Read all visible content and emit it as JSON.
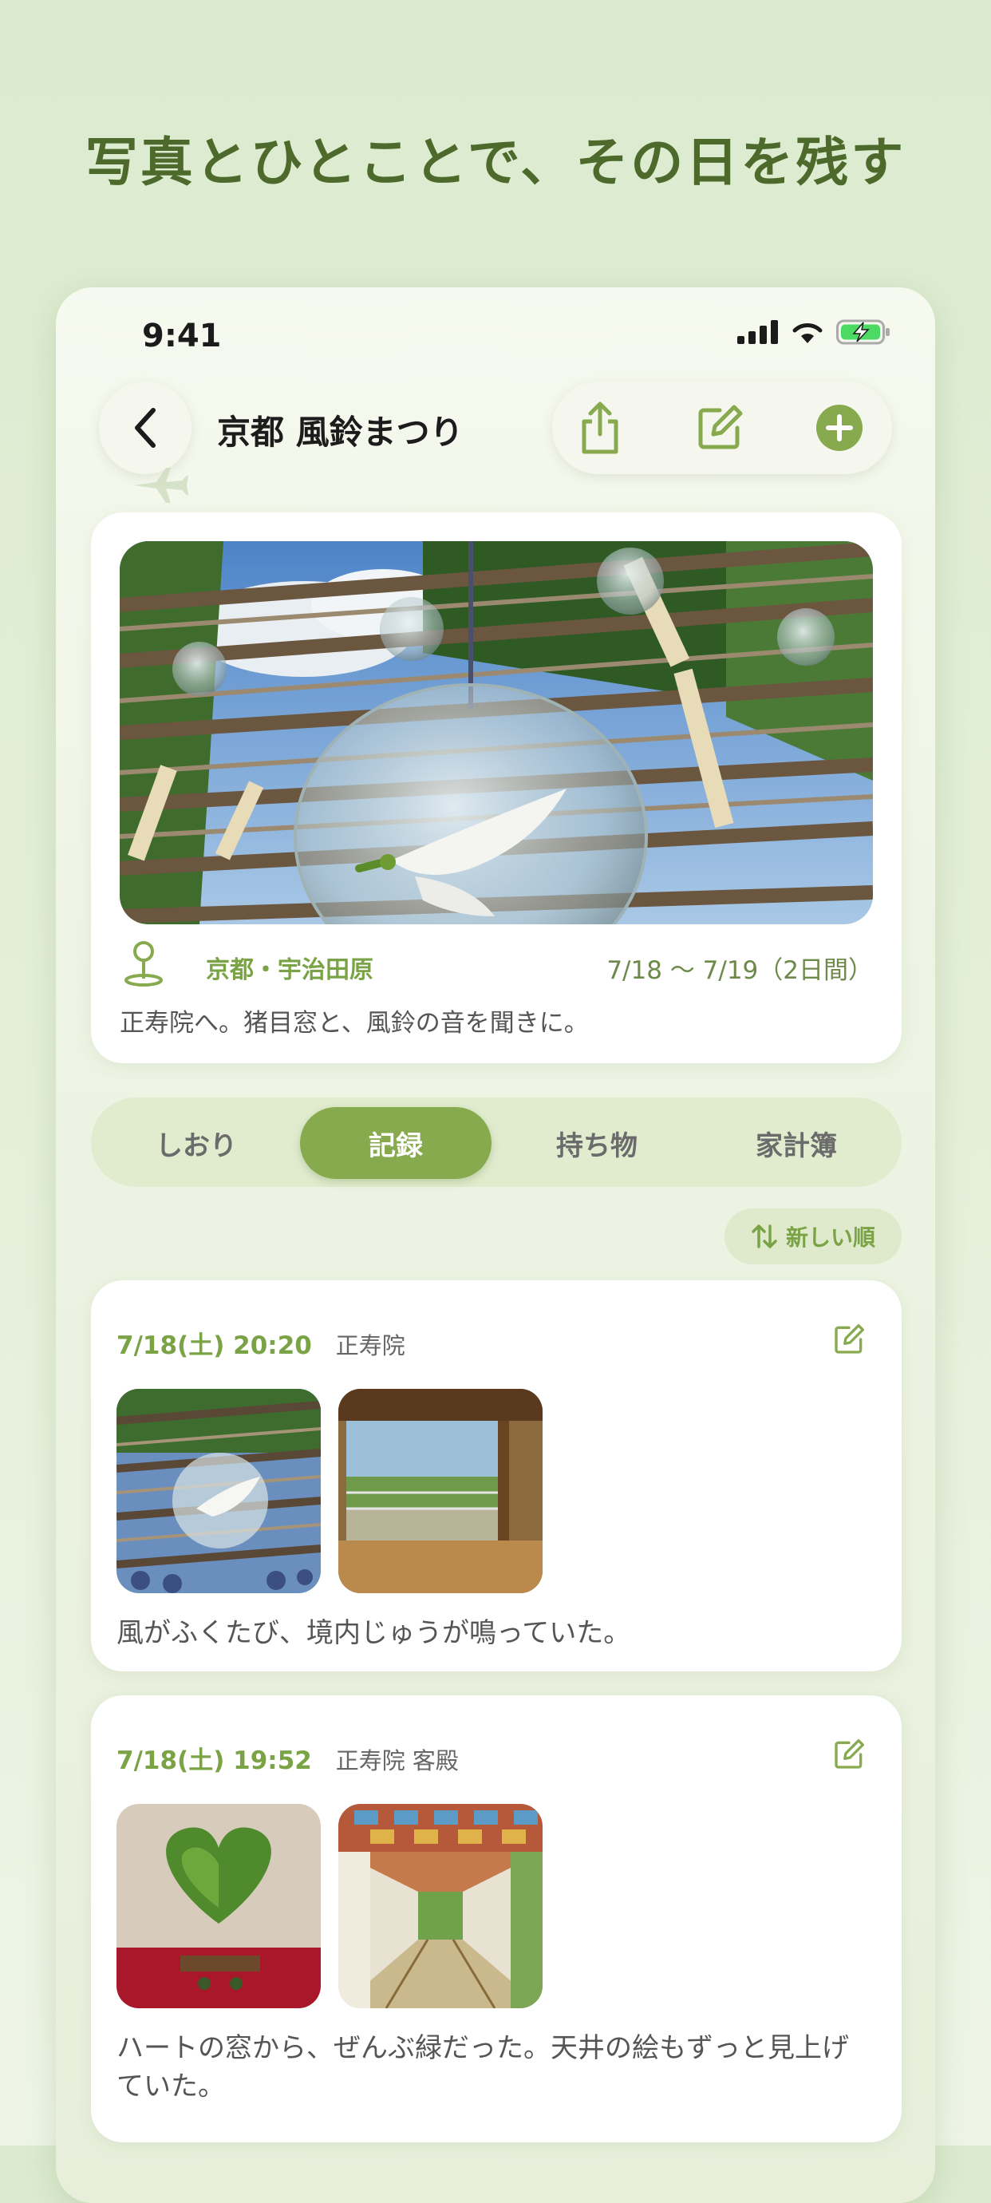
{
  "headline": "写真とひとことで、その日を残す",
  "status": {
    "time": "9:41"
  },
  "nav": {
    "title": "京都 風鈴まつり"
  },
  "trip": {
    "location": "京都・宇治田原",
    "dates": "7/18 〜 7/19（2日間）",
    "description": "正寿院へ。猪目窓と、風鈴の音を聞きに。"
  },
  "tabs": [
    {
      "label": "しおり",
      "active": false
    },
    {
      "label": "記録",
      "active": true
    },
    {
      "label": "持ち物",
      "active": false
    },
    {
      "label": "家計簿",
      "active": false
    }
  ],
  "sort": {
    "label": "新しい順"
  },
  "entries": [
    {
      "datetime": "7/18(土) 20:20",
      "place": "正寿院",
      "text": "風がふくたび、境内じゅうが鳴っていた。"
    },
    {
      "datetime": "7/18(土) 19:52",
      "place": "正寿院 客殿",
      "text": "ハートの窓から、ぜんぶ緑だった。天井の絵もずっと見上げていた。"
    }
  ],
  "colors": {
    "accent": "#86aa4d",
    "headline": "#4d6a2c",
    "tab_bg": "#e1eccf"
  }
}
